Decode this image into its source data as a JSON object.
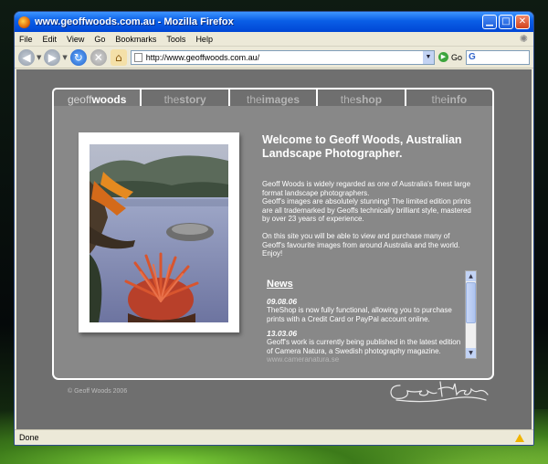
{
  "window": {
    "title": "www.geoffwoods.com.au - Mozilla Firefox",
    "minimize_icon": "minimize-icon",
    "maximize_icon": "maximize-icon",
    "close_icon": "close-icon"
  },
  "menu": {
    "file": "File",
    "edit": "Edit",
    "view": "View",
    "go": "Go",
    "bookmarks": "Bookmarks",
    "tools": "Tools",
    "help": "Help"
  },
  "toolbar": {
    "url": "http://www.geoffwoods.com.au/",
    "go_label": "Go",
    "search_engine_icon": "google-icon"
  },
  "site": {
    "tabs": [
      {
        "pre": "geoff",
        "post": "woods",
        "active": true
      },
      {
        "pre": "the",
        "post": "story",
        "active": false
      },
      {
        "pre": "the",
        "post": "images",
        "active": false
      },
      {
        "pre": "the",
        "post": "shop",
        "active": false
      },
      {
        "pre": "the",
        "post": "info",
        "active": false
      }
    ],
    "welcome": "Welcome to Geoff Woods, Australian Landscape Photographer.",
    "intro_1": "Geoff Woods is widely regarded as one of Australia's finest large format landscape photographers.",
    "intro_2": "Geoff's images are absolutely stunning! The limited edition prints are all trademarked by Geoffs technically brilliant style, mastered by over 23 years of experience.",
    "intro_3": "On this site you will be able to view and purchase many of Geoff's favourite images from around Australia and the world. Enjoy!",
    "news": {
      "title": "News",
      "items": [
        {
          "date": "09.08.06",
          "text": "TheShop is now fully functional, allowing you to purchase prints with a Credit Card or PayPal account online.",
          "link": ""
        },
        {
          "date": "13.03.06",
          "text": "Geoff's work is currently being published in the latest edition of Camera Natura, a Swedish photography magazine. ",
          "link": "www.cameranatura.se"
        }
      ]
    },
    "copyright": "© Geoff Woods 2006"
  },
  "status": {
    "text": "Done"
  },
  "colors": {
    "page_bg": "#6f6f6f",
    "panel_bg": "#888888",
    "titlebar": "#0a5ee6"
  }
}
